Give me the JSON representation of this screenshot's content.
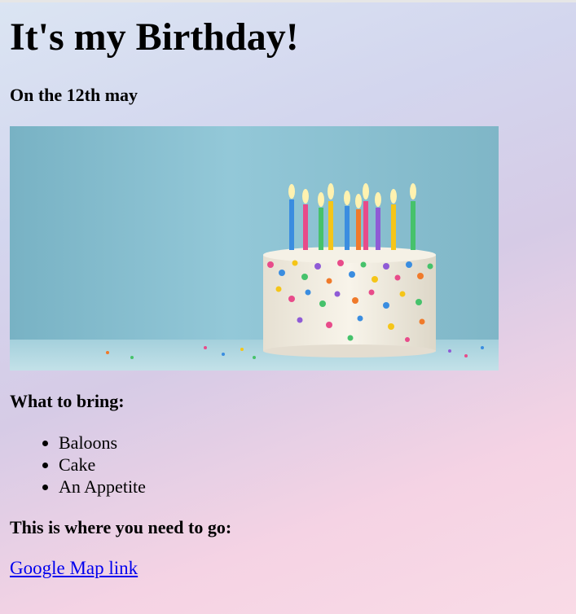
{
  "page": {
    "title": "It's my Birthday!",
    "date_line": "On the 12th may"
  },
  "image": {
    "icon": "birthday-cake-photo",
    "colors": {
      "sky": "#8cc3d3",
      "frosting": "#f3eee2",
      "candle_flame": "#fff2b0"
    }
  },
  "bring": {
    "heading": "What to bring:",
    "items": [
      "Baloons",
      "Cake",
      "An Appetite"
    ]
  },
  "directions": {
    "heading": "This is where you need to go:",
    "link_text": "Google Map link"
  },
  "colors": {
    "link": "#0000ee",
    "background_top": "#dbe5f3",
    "background_bottom": "#f9dbe6"
  }
}
